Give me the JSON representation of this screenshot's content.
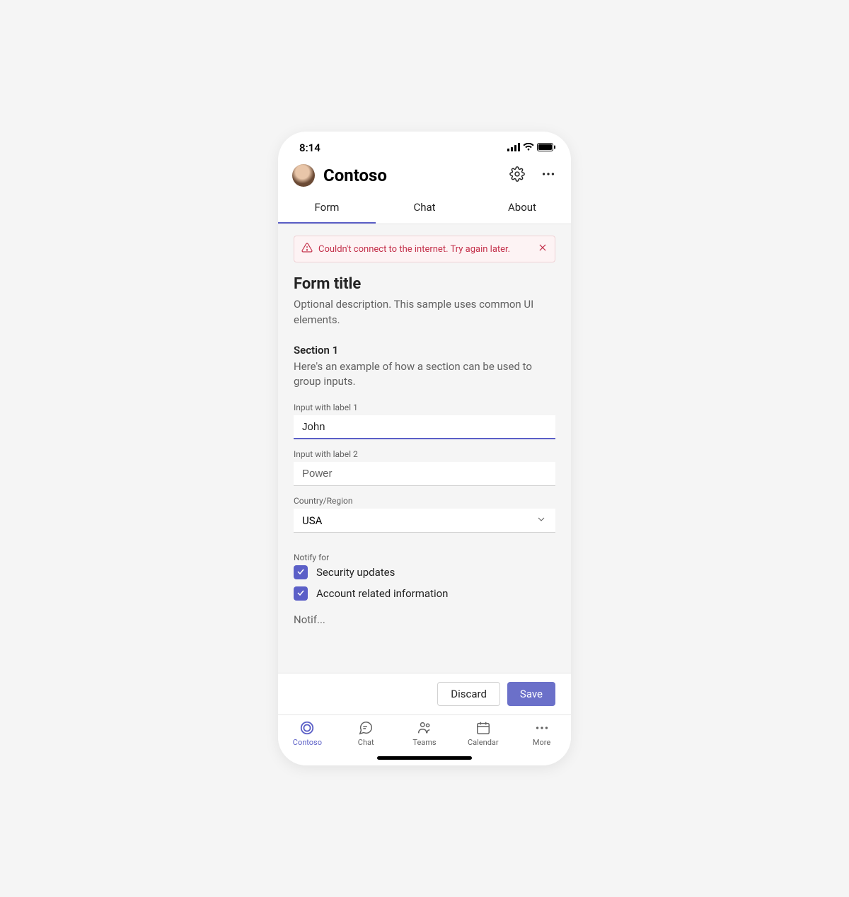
{
  "status": {
    "time": "8:14"
  },
  "header": {
    "title": "Contoso"
  },
  "tabs": [
    {
      "label": "Form",
      "active": true
    },
    {
      "label": "Chat",
      "active": false
    },
    {
      "label": "About",
      "active": false
    }
  ],
  "error": {
    "message": "Couldn't connect to the internet. Try again later."
  },
  "form": {
    "title": "Form title",
    "description": "Optional description. This sample uses common UI elements.",
    "section": {
      "title": "Section 1",
      "description": "Here's an example of how a section can be used to group inputs."
    },
    "fields": {
      "input1": {
        "label": "Input with label 1",
        "value": "John"
      },
      "input2": {
        "label": "Input with label 2",
        "value": "Power"
      },
      "country": {
        "label": "Country/Region",
        "value": "USA"
      }
    },
    "notify": {
      "label": "Notify for",
      "options": [
        {
          "label": "Security updates",
          "checked": true
        },
        {
          "label": "Account related information",
          "checked": true
        }
      ]
    },
    "truncated_label": "Notif..."
  },
  "actions": {
    "discard": "Discard",
    "save": "Save"
  },
  "nav": [
    {
      "label": "Contoso",
      "active": true
    },
    {
      "label": "Chat",
      "active": false
    },
    {
      "label": "Teams",
      "active": false
    },
    {
      "label": "Calendar",
      "active": false
    },
    {
      "label": "More",
      "active": false
    }
  ]
}
